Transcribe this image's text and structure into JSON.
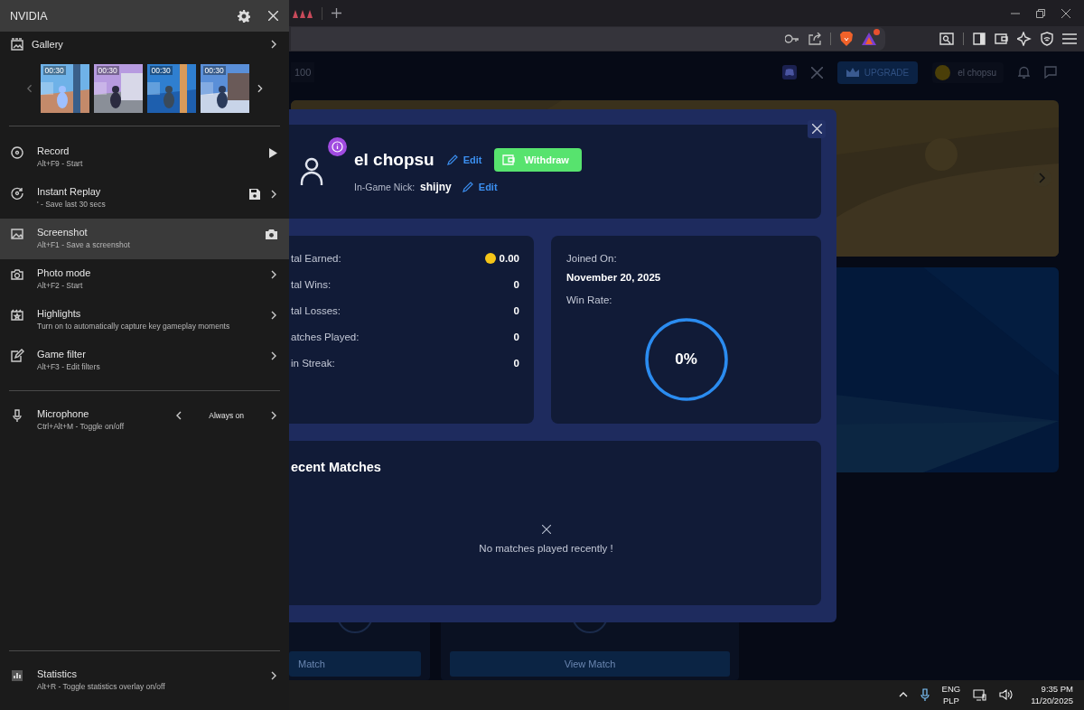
{
  "overlay": {
    "title": "NVIDIA",
    "gallery": {
      "label": "Gallery",
      "thumbnails": [
        {
          "duration": "00:30"
        },
        {
          "duration": "00:30"
        },
        {
          "duration": "00:30"
        },
        {
          "duration": "00:30"
        }
      ]
    },
    "items": [
      {
        "kind": "play",
        "label": "Record",
        "hint": "Alt+F9 - Start",
        "selected": false
      },
      {
        "kind": "save",
        "label": "Instant Replay",
        "hint": "' - Save last 30 secs",
        "selected": false
      },
      {
        "kind": "camera",
        "label": "Screenshot",
        "hint": "Alt+F1 - Save a screenshot",
        "selected": true
      },
      {
        "kind": "menu",
        "label": "Photo mode",
        "hint": "Alt+F2 - Start",
        "selected": false
      },
      {
        "kind": "menu",
        "label": "Highlights",
        "hint": "Turn on to automatically capture key gameplay moments",
        "selected": false
      },
      {
        "kind": "menu",
        "label": "Game filter",
        "hint": "Alt+F3 - Edit filters",
        "selected": false
      }
    ],
    "microphone": {
      "label": "Microphone",
      "hint": "Ctrl+Alt+M - Toggle on/off",
      "value": "Always on"
    },
    "statistics": {
      "label": "Statistics",
      "hint": "Alt+R - Toggle statistics overlay on/off"
    }
  },
  "browser": {
    "nav": {
      "count": "100",
      "upgrade": "UPGRADE",
      "user": "el chopsu"
    },
    "match_buttons": [
      "Match",
      "View Match"
    ]
  },
  "profile_modal": {
    "name": "el chopsu",
    "name_edit": "Edit",
    "withdraw": "Withdraw",
    "nick_label": "In-Game Nick:",
    "nick": "shijny",
    "nick_edit": "Edit",
    "stats": [
      {
        "kind": "coins",
        "label": "tal Earned:",
        "value": "0.00"
      },
      {
        "kind": "count",
        "label": "tal Wins:",
        "value": "0"
      },
      {
        "kind": "count",
        "label": "tal Losses:",
        "value": "0"
      },
      {
        "kind": "count",
        "label": "atches Played:",
        "value": "0"
      },
      {
        "kind": "count",
        "label": "in Streak:",
        "value": "0"
      }
    ],
    "joined_label": "Joined On:",
    "joined_date": "November 20, 2025",
    "win_rate_label": "Win Rate:",
    "win_rate": {
      "value": "0%"
    },
    "recent_title": "ecent Matches",
    "recent_empty": "No matches played recently !"
  },
  "taskbar": {
    "language": "ENG",
    "layout": "PLP",
    "time": "9:35 PM",
    "date": "11/20/2025"
  }
}
